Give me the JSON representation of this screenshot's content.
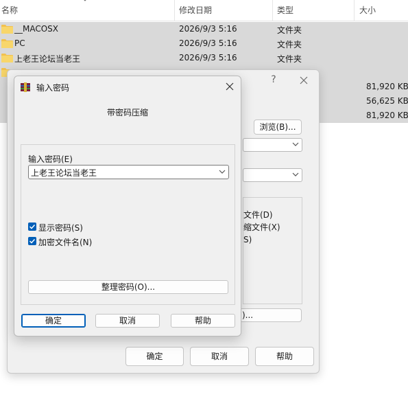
{
  "explorer": {
    "columns": {
      "name": "名称",
      "modified": "修改日期",
      "type": "类型",
      "size": "大小"
    },
    "rows": [
      {
        "name": "__MACOSX",
        "date": "2026/9/3 5:16",
        "type": "文件夹",
        "size": "",
        "icon": "folder-icon"
      },
      {
        "name": "PC",
        "date": "2026/9/3 5:16",
        "type": "文件夹",
        "size": "",
        "icon": "folder-icon"
      },
      {
        "name": "上老王论坛当老王",
        "date": "2026/9/3 5:16",
        "type": "文件夹",
        "size": "",
        "icon": "folder-icon"
      }
    ],
    "size_values": [
      "81,920 KB",
      "56,625 KB",
      "81,920 KB"
    ]
  },
  "background_dialog": {
    "help_glyph": "?",
    "browse_button": "浏览(B)...",
    "options": [
      "文件(D)",
      "缩文件(X)",
      "S)"
    ],
    "partial_button": ")...",
    "ok": "确定",
    "cancel": "取消",
    "help": "帮助"
  },
  "password_dialog": {
    "title": "输入密码",
    "subtitle": "带密码压缩",
    "password_label": "输入密码(E)",
    "password_value": "上老王论坛当老王",
    "show_password": "显示密码(S)",
    "encrypt_names": "加密文件名(N)",
    "manage_button": "整理密码(O)...",
    "ok": "确定",
    "cancel": "取消",
    "help": "帮助"
  },
  "colors": {
    "accent": "#005fb8",
    "selected_row": "#d9d9d9",
    "folder": "#f2c14e"
  }
}
